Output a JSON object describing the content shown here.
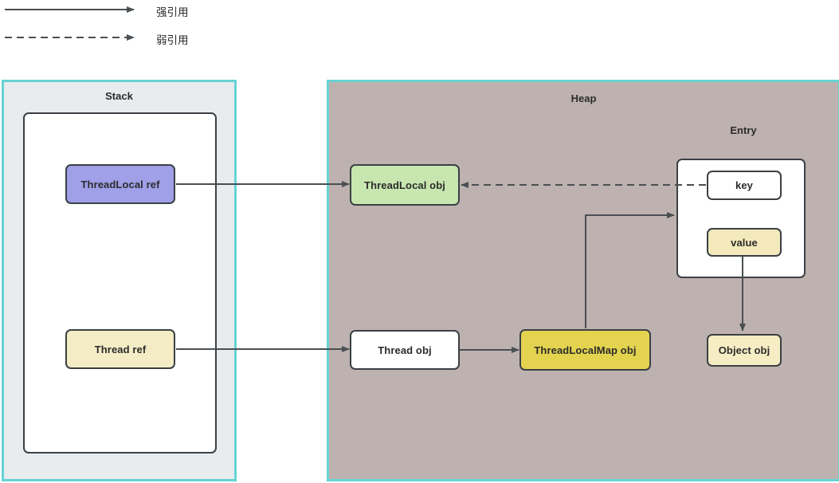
{
  "legend": {
    "items": [
      {
        "id": "strong-reference",
        "label": "强引用",
        "style": "solid"
      },
      {
        "id": "weak-reference",
        "label": "弱引用",
        "style": "dashed"
      }
    ]
  },
  "containers": {
    "stack": {
      "title": "Stack",
      "border_color": "#67d3d3",
      "fill_color": "#e8ecee"
    },
    "heap": {
      "title": "Heap",
      "border_color": "#67d3d3",
      "fill_color": "#bdb2af"
    },
    "entry": {
      "title": "Entry",
      "fill_color": "#ffffff",
      "border_color": "#3b4044"
    }
  },
  "nodes": {
    "threadlocal_ref": {
      "label": "ThreadLocal ref",
      "fill": "#9fa0e8"
    },
    "thread_ref": {
      "label": "Thread ref",
      "fill": "#f3ecc4"
    },
    "threadlocal_obj": {
      "label": "ThreadLocal obj",
      "fill": "#c8e6b0"
    },
    "thread_obj": {
      "label": "Thread obj",
      "fill": "#ffffff"
    },
    "threadlocalmap_obj": {
      "label": "ThreadLocalMap obj",
      "fill": "#e3d34f"
    },
    "key": {
      "label": "key",
      "fill": "#ffffff"
    },
    "value": {
      "label": "value",
      "fill": "#f3e9bb"
    },
    "object_obj": {
      "label": "Object obj",
      "fill": "#f6edc4"
    }
  },
  "edges": [
    {
      "id": "threadlocal-ref-to-threadlocal-obj",
      "style": "solid",
      "from": "threadlocal_ref",
      "to": "threadlocal_obj"
    },
    {
      "id": "key-to-threadlocal-obj",
      "style": "dashed",
      "from": "key",
      "to": "threadlocal_obj"
    },
    {
      "id": "thread-ref-to-thread-obj",
      "style": "solid",
      "from": "thread_ref",
      "to": "thread_obj"
    },
    {
      "id": "thread-obj-to-threadlocalmap-obj",
      "style": "solid",
      "from": "thread_obj",
      "to": "threadlocalmap_obj"
    },
    {
      "id": "threadlocalmap-obj-to-entry",
      "style": "solid",
      "from": "threadlocalmap_obj",
      "to": "entry"
    },
    {
      "id": "value-to-object-obj",
      "style": "solid",
      "from": "value",
      "to": "object_obj"
    }
  ],
  "colors": {
    "line": "#4a4f53",
    "text": "#2b2b2b",
    "node_border": "#3b4044",
    "accent_cyan": "#67d3d3"
  }
}
